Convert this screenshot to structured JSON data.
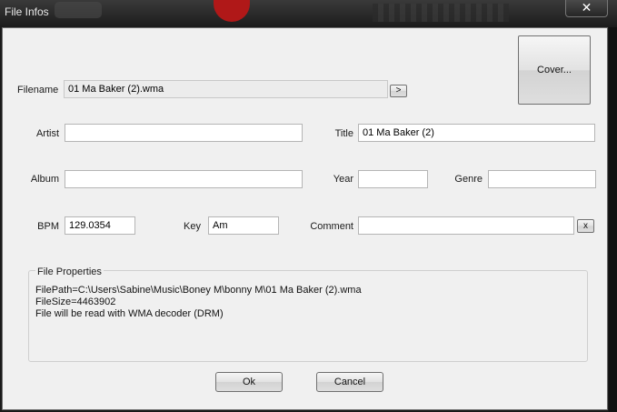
{
  "window": {
    "title": "File Infos",
    "close_glyph": "✕"
  },
  "cover_button": {
    "label": "Cover..."
  },
  "filename": {
    "label": "Filename",
    "value": "01 Ma Baker (2).wma",
    "browse_label": ">"
  },
  "artist": {
    "label": "Artist",
    "value": ""
  },
  "title_field": {
    "label": "Title",
    "value": "01 Ma Baker (2)"
  },
  "album": {
    "label": "Album",
    "value": ""
  },
  "year": {
    "label": "Year",
    "value": ""
  },
  "genre": {
    "label": "Genre",
    "value": ""
  },
  "bpm": {
    "label": "BPM",
    "value": "129.0354"
  },
  "key": {
    "label": "Key",
    "value": "Am"
  },
  "comment": {
    "label": "Comment",
    "value": "",
    "clear_label": "x"
  },
  "file_properties": {
    "heading": "File Properties",
    "lines": [
      "FilePath=C:\\Users\\Sabine\\Music\\Boney M\\bonny M\\01 Ma Baker (2).wma",
      "FileSize=4463902",
      "File will be read with WMA decoder (DRM)"
    ]
  },
  "buttons": {
    "ok": "Ok",
    "cancel": "Cancel"
  }
}
